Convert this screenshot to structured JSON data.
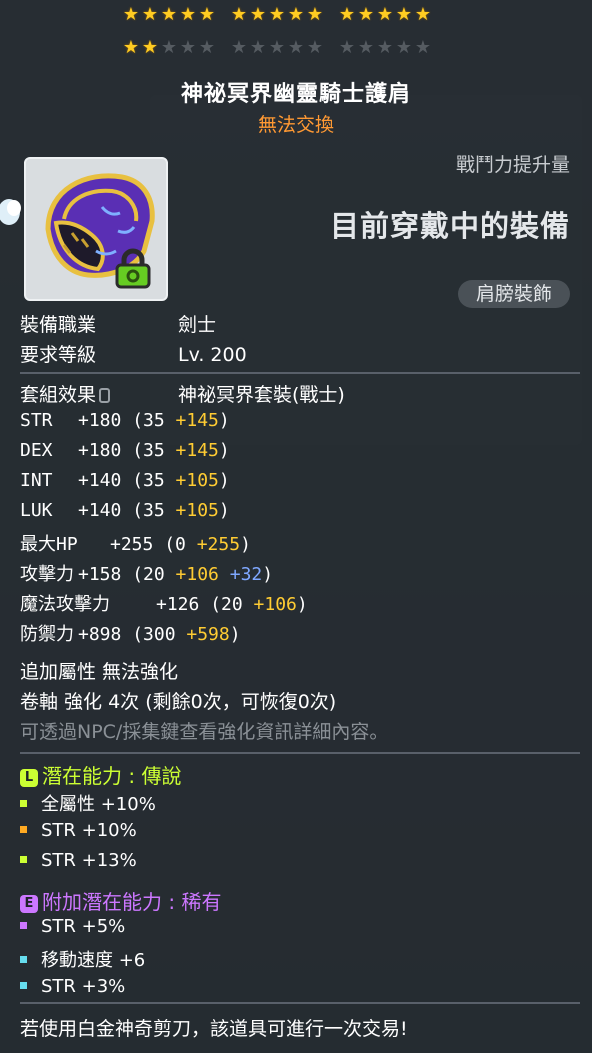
{
  "colors": {
    "legendary": "#ccff33",
    "epic": "#cc77ff",
    "orange": "#ff9933",
    "bonus_yellow": "#ffcc33",
    "bonus_blue": "#7fa8ff",
    "star_on": "#ffcc22",
    "star_off": "#555b61"
  },
  "stars": {
    "total": 30,
    "filled": 17
  },
  "item": {
    "name": "神祕冥界幽靈騎士護肩",
    "trade_status": "無法交換",
    "icon": "shoulder-armor-icon",
    "lock_icon": "lock-icon"
  },
  "compare": {
    "power_label": "戰鬥力提升量",
    "equipped_label": "目前穿戴中的裝備",
    "slot": "肩膀裝飾"
  },
  "requirements": {
    "job_label": "裝備職業",
    "job_value": "劍士",
    "level_label": "要求等級",
    "level_value": "Lv. 200"
  },
  "set": {
    "label": "套組效果",
    "value": "神祕冥界套裝(戰士)"
  },
  "stats": [
    {
      "name": "STR",
      "total": "+180",
      "base": "(35",
      "bonus": "+145",
      "extra": "",
      "close": ")"
    },
    {
      "name": "DEX",
      "total": "+180",
      "base": "(35",
      "bonus": "+145",
      "extra": "",
      "close": ")"
    },
    {
      "name": "INT",
      "total": "+140",
      "base": "(35",
      "bonus": "+105",
      "extra": "",
      "close": ")"
    },
    {
      "name": "LUK",
      "total": "+140",
      "base": "(35",
      "bonus": "+105",
      "extra": "",
      "close": ")"
    },
    {
      "name": "最大HP",
      "total": "+255",
      "base": "(0",
      "bonus": "+255",
      "extra": "",
      "close": ")"
    },
    {
      "name": "攻擊力",
      "total": "+158",
      "base": "(20",
      "bonus": "+106",
      "extra": "+32",
      "close": ")"
    },
    {
      "name": "魔法攻擊力",
      "total": "+126",
      "base": "(20",
      "bonus": "+106",
      "extra": "",
      "close": ")"
    },
    {
      "name": "防禦力",
      "total": "+898",
      "base": "(300",
      "bonus": "+598",
      "extra": "",
      "close": ")"
    }
  ],
  "extra": {
    "bonus_attr": "追加屬性 無法強化",
    "scroll": "卷軸 強化 4次 (剩餘0次，可恢復0次)",
    "hint": "可透過NPC/採集鍵查看強化資訊詳細內容。"
  },
  "potential": {
    "tag": "L",
    "label": "潛在能力 : 傳說",
    "lines": [
      {
        "text": "全屬性 +10%",
        "bullet": "#ccff33"
      },
      {
        "text": "STR +10%",
        "bullet": "#ffaa22"
      },
      {
        "text": "STR +13%",
        "bullet": "#ccff33"
      }
    ]
  },
  "bonus_potential": {
    "tag": "E",
    "label": "附加潛在能力 : 稀有",
    "lines": [
      {
        "text": "STR +5%",
        "bullet": "#cc77ff"
      },
      {
        "text": "移動速度 +6",
        "bullet": "#66ddee"
      },
      {
        "text": "STR +3%",
        "bullet": "#66ddee"
      }
    ]
  },
  "footer": "若使用白金神奇剪刀，該道具可進行一次交易!"
}
